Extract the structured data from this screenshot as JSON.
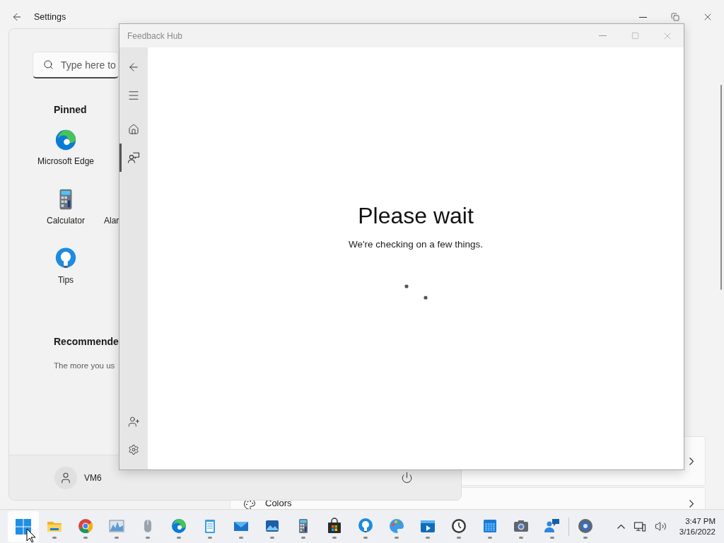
{
  "settings": {
    "title": "Settings",
    "cards": [
      {
        "kind": "blank"
      },
      {
        "kind": "item",
        "label": "Colors"
      }
    ]
  },
  "start_menu": {
    "search": {
      "placeholder": "Type here to"
    },
    "pinned_title": "Pinned",
    "pinned": [
      {
        "kind": "edge",
        "label": "Microsoft Edge"
      },
      {
        "kind": "calculator",
        "label": "Calculator"
      },
      {
        "kind": "partial",
        "label": "Alar"
      },
      {
        "kind": "tips",
        "label": "Tips"
      }
    ],
    "recommended_title": "Recommende",
    "recommended_text": "The more you us",
    "user": "VM6"
  },
  "feedback_hub": {
    "title": "Feedback Hub",
    "nav": [
      {
        "kind": "home",
        "selected": false
      },
      {
        "kind": "feedback",
        "selected": true
      }
    ],
    "heading": "Please wait",
    "message": "We're checking on a few things."
  },
  "taskbar": {
    "start": {
      "selected": true
    },
    "apps": [
      {
        "kind": "folder",
        "running": true
      },
      {
        "kind": "chrome",
        "running": true
      },
      {
        "kind": "chart",
        "running": true
      },
      {
        "kind": "mouse",
        "running": true
      },
      {
        "kind": "edge",
        "running": true
      },
      {
        "kind": "notepad",
        "running": true
      },
      {
        "kind": "mail",
        "running": true
      },
      {
        "kind": "photos",
        "running": true
      },
      {
        "kind": "calculator",
        "running": true
      },
      {
        "kind": "store",
        "running": true
      },
      {
        "kind": "tips",
        "running": true
      },
      {
        "kind": "paint",
        "running": true
      },
      {
        "kind": "video",
        "running": true
      },
      {
        "kind": "clock",
        "running": true
      },
      {
        "kind": "calendar",
        "running": true
      },
      {
        "kind": "camera",
        "running": true
      },
      {
        "kind": "feedback",
        "running": true
      },
      {
        "kind": "settings",
        "running": true
      }
    ],
    "time": "3:47 PM",
    "date": "3/16/2022"
  }
}
